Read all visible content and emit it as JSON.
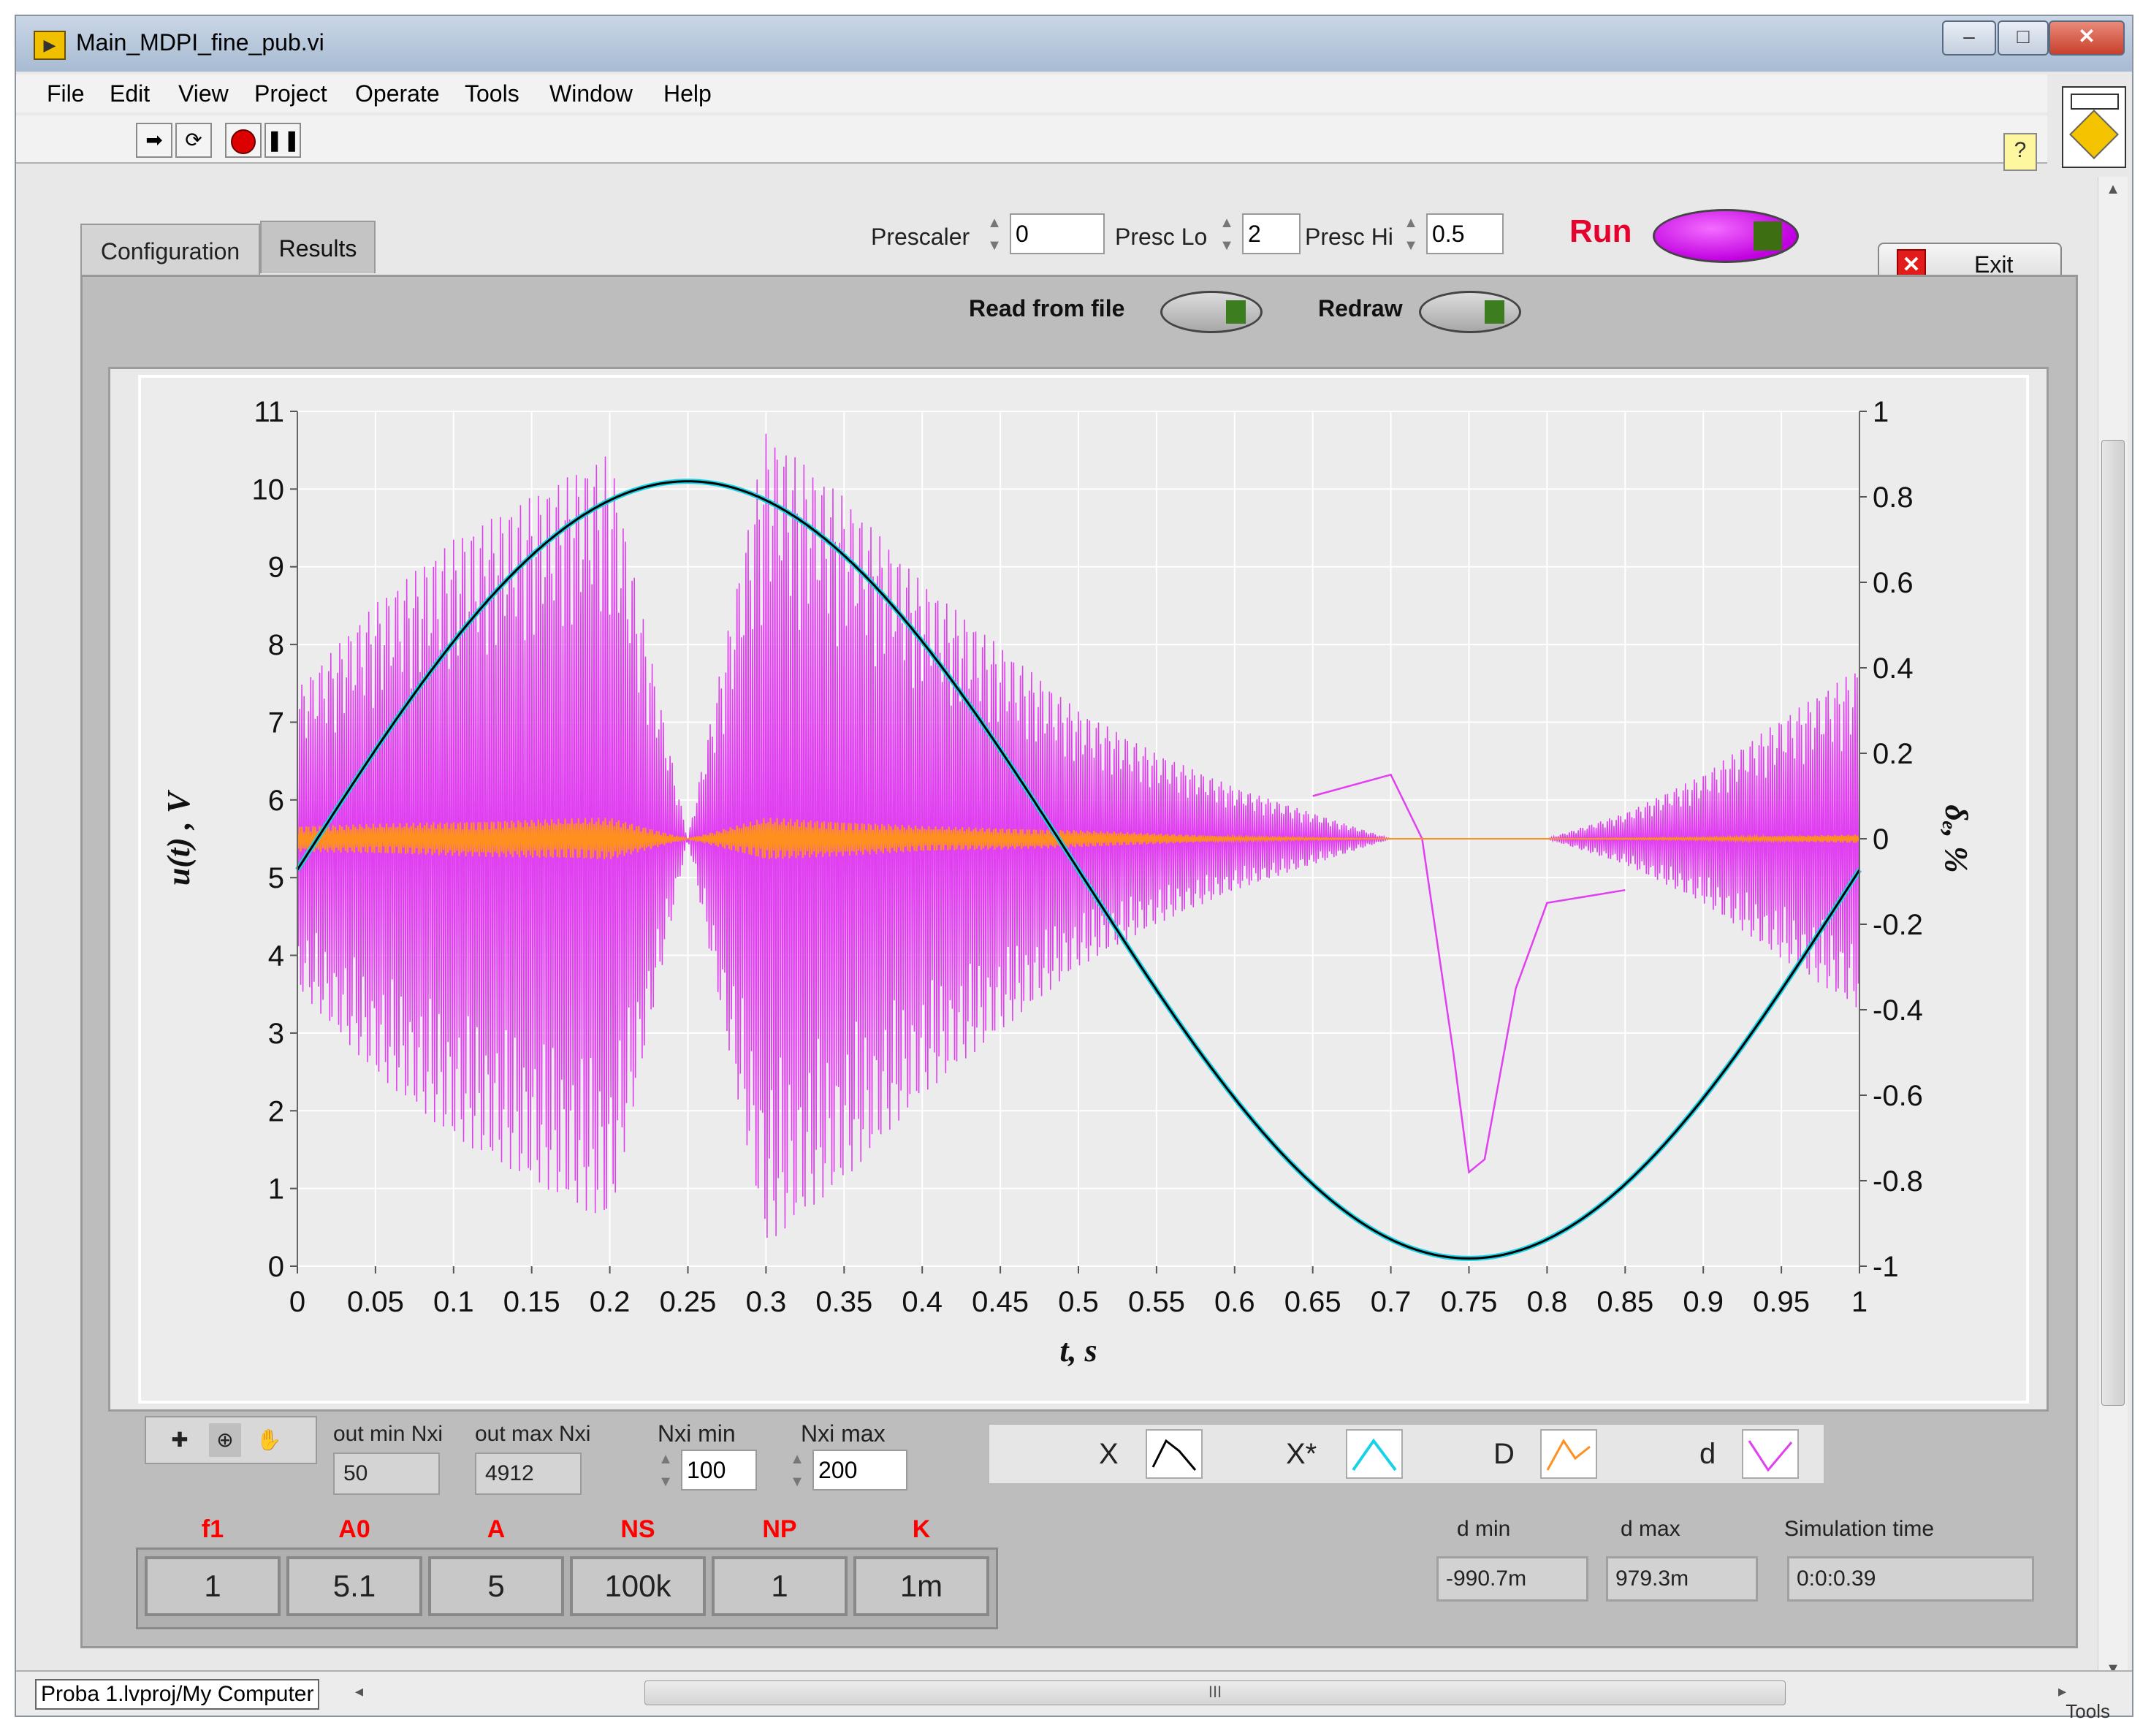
{
  "window": {
    "title": "Main_MDPI_fine_pub.vi"
  },
  "menu": [
    "File",
    "Edit",
    "View",
    "Project",
    "Operate",
    "Tools",
    "Window",
    "Help"
  ],
  "tabs": {
    "configuration": "Configuration",
    "results": "Results"
  },
  "controls": {
    "prescaler_label": "Prescaler",
    "prescaler_value": "0",
    "presc_lo_label": "Presc Lo",
    "presc_lo_value": "2",
    "presc_hi_label": "Presc Hi",
    "presc_hi_value": "0.5",
    "run_label": "Run",
    "exit_label": "Exit",
    "read_from_file_label": "Read from file",
    "redraw_label": "Redraw"
  },
  "chart_data": {
    "type": "line",
    "xlabel": "t, s",
    "ylabel_left": "u(t) , V",
    "ylabel_right": "δₑ, %",
    "x_range": [
      0,
      1
    ],
    "ylim_left": [
      0,
      11
    ],
    "ylim_right": [
      -1,
      1
    ],
    "x_ticks": [
      "0",
      "0.05",
      "0.1",
      "0.15",
      "0.2",
      "0.25",
      "0.3",
      "0.35",
      "0.4",
      "0.45",
      "0.5",
      "0.55",
      "0.6",
      "0.65",
      "0.7",
      "0.75",
      "0.8",
      "0.85",
      "0.9",
      "0.95",
      "1"
    ],
    "y_left_ticks": [
      "0",
      "1",
      "2",
      "3",
      "4",
      "5",
      "6",
      "7",
      "8",
      "9",
      "10",
      "11"
    ],
    "y_right_ticks": [
      "-1",
      "-0.8",
      "-0.6",
      "-0.4",
      "-0.2",
      "0",
      "0.2",
      "0.4",
      "0.6",
      "0.8",
      "1"
    ],
    "grid": true,
    "series": [
      {
        "name": "X",
        "color": "#000000",
        "axis": "left",
        "x": [
          0,
          0.125,
          0.25,
          0.375,
          0.5,
          0.625,
          0.75,
          0.875,
          1
        ],
        "y": [
          5.1,
          8.64,
          10.1,
          8.64,
          5.1,
          1.56,
          0.1,
          1.56,
          5.1
        ]
      },
      {
        "name": "X*",
        "color": "#19d2e6",
        "axis": "left",
        "x": [
          0,
          0.125,
          0.25,
          0.375,
          0.5,
          0.625,
          0.75,
          0.875,
          1
        ],
        "y": [
          5.1,
          8.64,
          10.1,
          8.64,
          5.1,
          1.56,
          0.1,
          1.56,
          5.1
        ]
      },
      {
        "name": "D",
        "color": "#ff9020",
        "axis": "right",
        "x": [
          0,
          0.1,
          0.2,
          0.25,
          0.3,
          0.4,
          0.5,
          0.6,
          0.7,
          0.8,
          0.9,
          1
        ],
        "envelope_half_width": [
          0.03,
          0.04,
          0.05,
          0.0,
          0.05,
          0.03,
          0.02,
          0.005,
          0.0,
          0.0,
          0.003,
          0.01
        ]
      },
      {
        "name": "d",
        "color": "#e040f0",
        "axis": "right",
        "x": [
          0,
          0.05,
          0.1,
          0.15,
          0.2,
          0.25,
          0.3,
          0.35,
          0.4,
          0.45,
          0.5,
          0.55,
          0.6,
          0.65,
          0.7,
          0.72,
          0.75,
          0.8,
          0.85,
          0.9,
          0.95,
          1
        ],
        "envelope_half_width": [
          0.35,
          0.55,
          0.7,
          0.8,
          0.9,
          0.0,
          0.95,
          0.8,
          0.6,
          0.45,
          0.3,
          0.2,
          0.12,
          0.06,
          0.0,
          0.0,
          0.0,
          0.0,
          0.06,
          0.15,
          0.28,
          0.4
        ]
      },
      {
        "name": "d_low_freq",
        "color": "#e040f0",
        "axis": "right",
        "x": [
          0.65,
          0.7,
          0.72,
          0.74,
          0.75,
          0.76,
          0.78,
          0.8,
          0.85
        ],
        "y": [
          0.1,
          0.15,
          0.0,
          -0.5,
          -0.78,
          -0.75,
          -0.35,
          -0.15,
          -0.12
        ]
      }
    ]
  },
  "tools": {
    "cursor_icon": "crosshair-icon",
    "zoom_icon": "zoom-icon",
    "pan_icon": "hand-icon"
  },
  "outputs": {
    "out_min_label": "out min Nxi",
    "out_min_value": "50",
    "out_max_label": "out max Nxi",
    "out_max_value": "4912",
    "nxi_min_label": "Nxi min",
    "nxi_min_value": "100",
    "nxi_max_label": "Nxi max",
    "nxi_max_value": "200"
  },
  "legend": [
    {
      "name": "X",
      "color": "#000000"
    },
    {
      "name": "X*",
      "color": "#19d2e6"
    },
    {
      "name": "D",
      "color": "#ff9020"
    },
    {
      "name": "d",
      "color": "#e040f0"
    }
  ],
  "params": [
    {
      "name": "f1",
      "value": "1"
    },
    {
      "name": "A0",
      "value": "5.1"
    },
    {
      "name": "A",
      "value": "5"
    },
    {
      "name": "NS",
      "value": "100k"
    },
    {
      "name": "NP",
      "value": "1"
    },
    {
      "name": "K",
      "value": "1m"
    }
  ],
  "stats": {
    "d_min_label": "d min",
    "d_min_value": "-990.7m",
    "d_max_label": "d max",
    "d_max_value": "979.3m",
    "sim_time_label": "Simulation time",
    "sim_time_value": "0:0:0.39"
  },
  "status": {
    "project_path": "Proba 1.lvproj/My Computer",
    "scroll_grip": "III",
    "tools_tab": "Tools"
  },
  "colors": {
    "run_accent": "#e6002e",
    "run_toggle": "#d21ef0",
    "param_label": "#ff0000",
    "window_chrome": "#a8bbd2"
  }
}
